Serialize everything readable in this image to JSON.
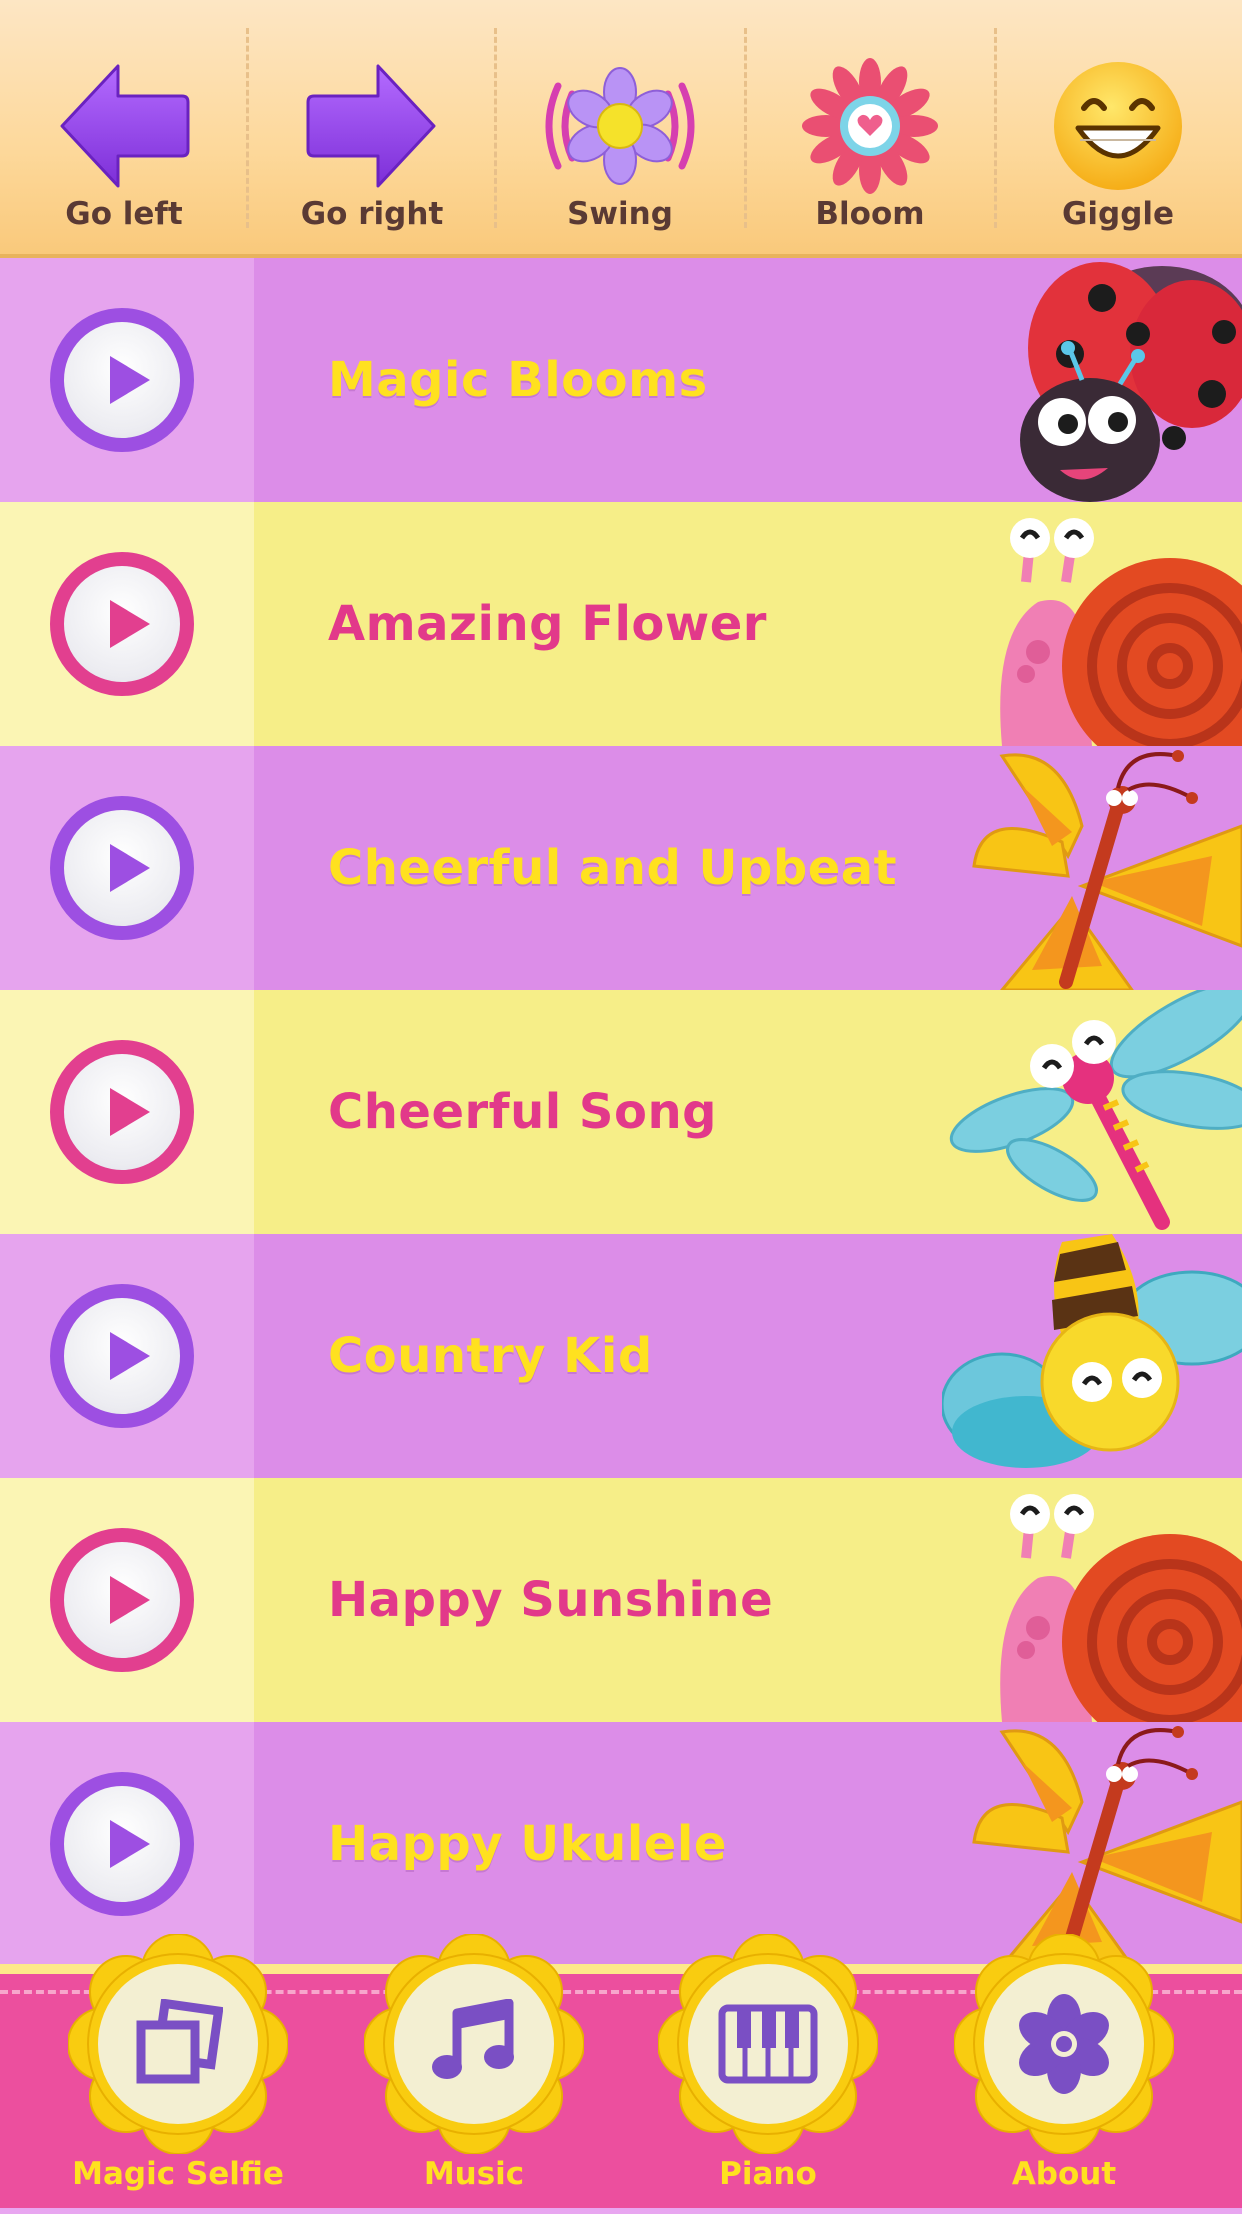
{
  "toolbar": {
    "tools": [
      {
        "label": "Go left",
        "icon": "arrow-left-icon"
      },
      {
        "label": "Go right",
        "icon": "arrow-right-icon"
      },
      {
        "label": "Swing",
        "icon": "swinging-flower-icon"
      },
      {
        "label": "Bloom",
        "icon": "bloom-flower-icon"
      },
      {
        "label": "Giggle",
        "icon": "giggle-face-icon"
      }
    ]
  },
  "songs": [
    {
      "title": "Magic Blooms",
      "theme": "purple",
      "critter": "ladybug"
    },
    {
      "title": "Amazing Flower",
      "theme": "yellow",
      "critter": "snail"
    },
    {
      "title": "Cheerful and Upbeat",
      "theme": "purple",
      "critter": "butterfly"
    },
    {
      "title": "Cheerful Song",
      "theme": "yellow",
      "critter": "dragonfly"
    },
    {
      "title": "Country Kid",
      "theme": "purple",
      "critter": "bee"
    },
    {
      "title": "Happy Sunshine",
      "theme": "yellow",
      "critter": "snail"
    },
    {
      "title": "Happy Ukulele",
      "theme": "purple",
      "critter": "butterfly"
    }
  ],
  "bottom_nav": [
    {
      "label": "Magic Selfie",
      "icon": "photos-icon"
    },
    {
      "label": "Music",
      "icon": "music-note-icon"
    },
    {
      "label": "Piano",
      "icon": "piano-keys-icon"
    },
    {
      "label": "About",
      "icon": "flower-icon"
    }
  ],
  "colors": {
    "purple_row": "#dc8de8",
    "yellow_row": "#f6ee88",
    "accent_purple": "#9d4fe2",
    "accent_pink": "#e23f8f",
    "title_yellow": "#ffe11f",
    "bottom_bar": "#ec4f9e"
  }
}
